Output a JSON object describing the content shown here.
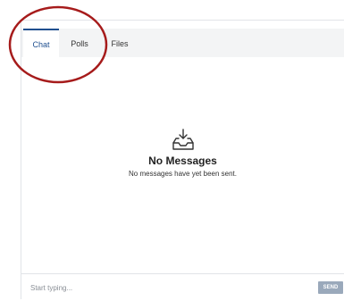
{
  "tabs": [
    {
      "label": "Chat",
      "active": true
    },
    {
      "label": "Polls",
      "active": false
    },
    {
      "label": "Files",
      "active": false
    }
  ],
  "empty_state": {
    "icon": "inbox-download-icon",
    "title": "No Messages",
    "subtitle": "No messages have yet been sent."
  },
  "composer": {
    "placeholder": "Start typing...",
    "send_label": "SEND"
  },
  "colors": {
    "accent": "#1f4f8f",
    "send_button": "#9aa9bb",
    "annotation_circle": "#a61b1b"
  }
}
